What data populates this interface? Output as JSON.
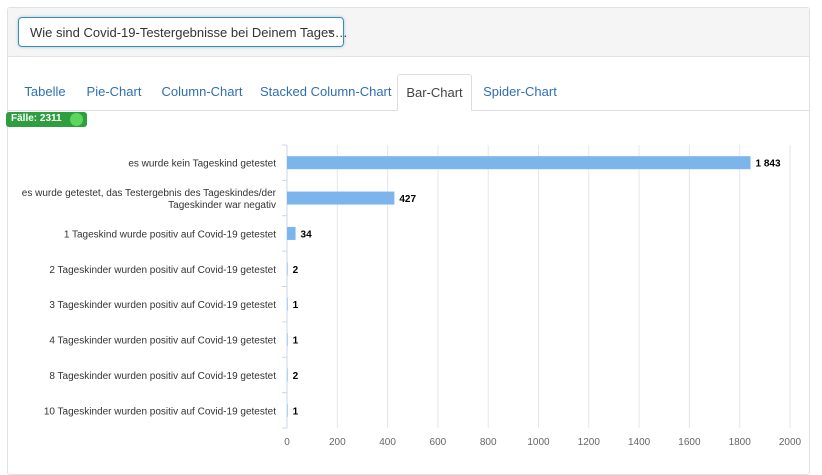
{
  "filter": {
    "selected": "Wie sind Covid-19-Testergebnisse bei Deinem Tages…"
  },
  "tabs": [
    {
      "label": "Tabelle",
      "active": false
    },
    {
      "label": "Pie-Chart",
      "active": false
    },
    {
      "label": "Column-Chart",
      "active": false
    },
    {
      "label": "Stacked Column-Chart",
      "active": false
    },
    {
      "label": "Bar-Chart",
      "active": true
    },
    {
      "label": "Spider-Chart",
      "active": false
    }
  ],
  "badge": {
    "label": "Fälle: 2311",
    "color": "#2e9e3e"
  },
  "chart_data": {
    "type": "bar",
    "orientation": "horizontal",
    "categories": [
      [
        "es wurde kein Tageskind getestet"
      ],
      [
        "es wurde getestet, das Testergebnis des Tageskindes/der",
        "Tageskinder war negativ"
      ],
      [
        "1 Tageskind wurde positiv auf Covid-19 getestet"
      ],
      [
        "2 Tageskinder wurden positiv auf Covid-19 getestet"
      ],
      [
        "3 Tageskinder wurden positiv auf Covid-19 getestet"
      ],
      [
        "4 Tageskinder wurden positiv auf Covid-19 getestet"
      ],
      [
        "8 Tageskinder wurden positiv auf Covid-19 getestet"
      ],
      [
        "10 Tageskinder wurden positiv auf Covid-19 getestet"
      ]
    ],
    "values": [
      1843,
      427,
      34,
      2,
      1,
      1,
      2,
      1
    ],
    "data_labels": [
      "1 843",
      "427",
      "34",
      "2",
      "1",
      "1",
      "2",
      "1"
    ],
    "xlim": [
      0,
      2000
    ],
    "ticks": [
      0,
      200,
      400,
      600,
      800,
      1000,
      1200,
      1400,
      1600,
      1800,
      2000
    ],
    "grid": true,
    "bar_color": "#7cb5ec",
    "grid_color": "#e6e6e6"
  }
}
